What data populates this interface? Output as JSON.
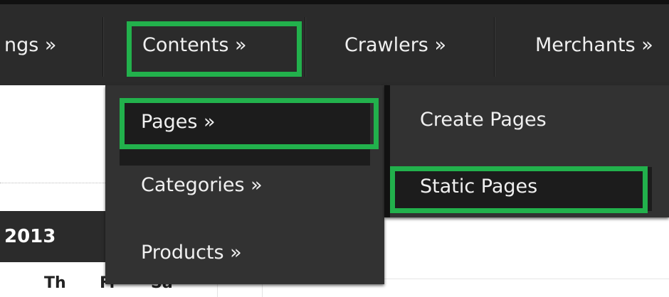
{
  "nav": {
    "items": [
      {
        "label": "ngs »"
      },
      {
        "label": "Contents »"
      },
      {
        "label": "Crawlers »"
      },
      {
        "label": "Merchants »"
      }
    ]
  },
  "submenu": {
    "items": [
      {
        "label": "Pages »"
      },
      {
        "label": "Categories »"
      },
      {
        "label": "Products »"
      }
    ]
  },
  "pages_submenu": {
    "items": [
      {
        "label": "Create Pages"
      },
      {
        "label": "Static Pages"
      }
    ]
  },
  "calendar": {
    "header": "2013",
    "days": [
      "Th",
      "Fr",
      "Sa"
    ]
  },
  "colors": {
    "highlight": "#22b14c",
    "bar": "#2b2b2b"
  }
}
